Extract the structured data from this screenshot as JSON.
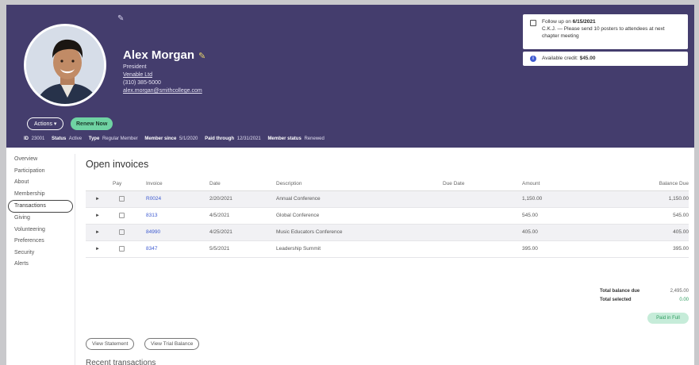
{
  "header": {
    "name": "Alex Morgan",
    "title": "President",
    "company": "Venable Ltd",
    "phone": "(310) 385-5000",
    "email": "alex.morgan@smithcollege.com",
    "actions_label": "Actions ▾",
    "renew_label": "Renew Now",
    "meta": [
      {
        "label": "ID",
        "value": "23001"
      },
      {
        "label": "Status",
        "value": "Active"
      },
      {
        "label": "Type",
        "value": "Regular Member"
      },
      {
        "label": "Member since",
        "value": "5/1/2020"
      },
      {
        "label": "Paid through",
        "value": "12/31/2021"
      },
      {
        "label": "Member status",
        "value": "Renewed"
      }
    ]
  },
  "notices": {
    "follow_prefix": "Follow up on ",
    "follow_date": "6/15/2021",
    "follow_text": "C.K.J. — Please send 10 posters to attendees at next chapter meeting",
    "credit_prefix": "Available credit: ",
    "credit_value": "$45.00",
    "credit_icon": "i"
  },
  "sidebar": {
    "items": [
      {
        "label": "Overview"
      },
      {
        "label": "Participation"
      },
      {
        "label": "About"
      },
      {
        "label": "Membership"
      },
      {
        "label": "Transactions",
        "active": true
      },
      {
        "label": "Giving"
      },
      {
        "label": "Volunteering"
      },
      {
        "label": "Preferences"
      },
      {
        "label": "Security"
      },
      {
        "label": "Alerts"
      }
    ]
  },
  "main": {
    "title": "Open invoices",
    "columns": [
      "Pay",
      "Invoice",
      "Date",
      "Description",
      "Due Date",
      "Amount",
      "Balance Due"
    ],
    "rows": [
      {
        "invoice": "R0024",
        "date": "2/20/2021",
        "description": "Annual Conference",
        "due": "",
        "amount": "1,150.00",
        "balance": "1,150.00"
      },
      {
        "invoice": "8313",
        "date": "4/5/2021",
        "description": "Global Conference",
        "due": "",
        "amount": "545.00",
        "balance": "545.00"
      },
      {
        "invoice": "84990",
        "date": "4/25/2021",
        "description": "Music Educators Conference",
        "due": "",
        "amount": "405.00",
        "balance": "405.00"
      },
      {
        "invoice": "8347",
        "date": "5/5/2021",
        "description": "Leadership Summit",
        "due": "",
        "amount": "395.00",
        "balance": "395.00"
      }
    ],
    "total_due_label": "Total balance due",
    "total_due_value": "2,495.00",
    "total_selected_label": "Total selected",
    "total_selected_value": "0.00",
    "paid_button": "Paid in Full",
    "view_statement": "View Statement",
    "view_trial_balance": "View Trial Balance",
    "recent_title": "Recent transactions"
  },
  "colors": {
    "header_bg": "#443d6d",
    "accent_green": "#6fd3a3",
    "link_blue": "#3d5ad0"
  }
}
